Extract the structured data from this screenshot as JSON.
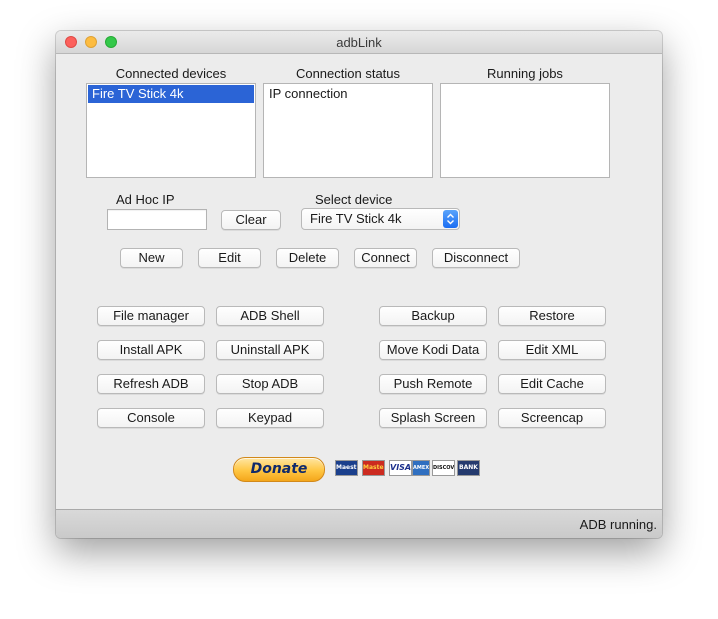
{
  "window": {
    "title": "adbLink"
  },
  "lists": {
    "connected_devices": {
      "label": "Connected devices",
      "items": [
        "Fire TV Stick 4k"
      ]
    },
    "connection_status": {
      "label": "Connection status",
      "items": [
        "IP connection"
      ]
    },
    "running_jobs": {
      "label": "Running jobs",
      "items": []
    }
  },
  "adhoc": {
    "label": "Ad Hoc IP",
    "value": "",
    "clear_label": "Clear"
  },
  "device_select": {
    "label": "Select device",
    "value": "Fire TV Stick 4k"
  },
  "device_buttons": {
    "new": "New",
    "edit": "Edit",
    "delete": "Delete",
    "connect": "Connect",
    "disconnect": "Disconnect"
  },
  "actions": {
    "file_manager": "File manager",
    "adb_shell": "ADB Shell",
    "install_apk": "Install APK",
    "uninstall_apk": "Uninstall APK",
    "refresh_adb": "Refresh ADB",
    "stop_adb": "Stop ADB",
    "console": "Console",
    "keypad": "Keypad",
    "backup": "Backup",
    "restore": "Restore",
    "move_kodi_data": "Move Kodi Data",
    "edit_xml": "Edit XML",
    "push_remote": "Push Remote",
    "edit_cache": "Edit Cache",
    "splash_screen": "Splash Screen",
    "screencap": "Screencap"
  },
  "donate": {
    "label": "Donate",
    "cards": [
      "Maestro",
      "MasterCard",
      "VISA",
      "AMEX",
      "DISCOVER",
      "BANK"
    ]
  },
  "status": {
    "text": "ADB running."
  },
  "colors": {
    "selection": "#2b64d6",
    "donate_text": "#102a6b"
  }
}
